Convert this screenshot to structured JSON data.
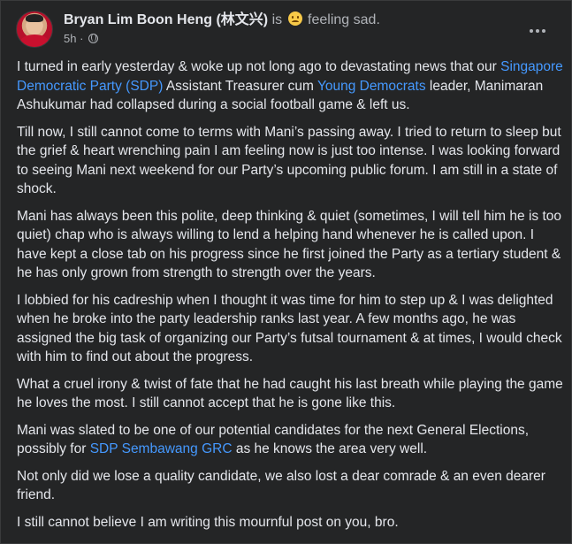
{
  "post": {
    "author": "Bryan Lim Boon Heng (林文兴)",
    "is_text": "is",
    "feeling": "feeling sad.",
    "feeling_icon": "sad-face-emoji",
    "time": "5h",
    "dot": "·",
    "privacy_icon": "globe-icon",
    "more_icon": "more-horizontal-icon",
    "paragraphs": {
      "p1": {
        "a": "I turned in early yesterday & woke up not long ago to devastating news that our ",
        "link1": "Singapore Democratic Party (SDP)",
        "b": " Assistant Treasurer cum ",
        "link2": "Young Democrats",
        "c": " leader, Manimaran Ashukumar had collapsed during a social football game & left us."
      },
      "p2": "Till now, I still cannot come to terms with Mani’s passing away.  I tried to return to sleep but the grief & heart wrenching pain I am feeling now is just too intense.  I was looking forward to seeing Mani next weekend for our Party’s upcoming public forum.  I am still in a state of shock.",
      "p3": "Mani has always been this polite, deep thinking & quiet (sometimes, I will tell him he is too quiet) chap who is always willing to lend a helping hand whenever he is called upon.  I have kept a close tab on his progress since he first joined the Party as a tertiary student & he has only grown from strength to strength over the years.",
      "p4": "I lobbied for his cadreship when I thought it was time for him to step up & I was delighted when he broke into the party leadership ranks last year.  A few months ago, he was assigned the big task of organizing our Party’s futsal tournament & at times, I would check with him to find out about the progress.",
      "p5": "What a cruel irony & twist of fate that he had caught his last breath while playing the game he loves the most.  I still cannot accept that he is gone like this.",
      "p6": {
        "a": "Mani was slated to be one of our potential candidates for the next General Elections, possibly for ",
        "link": "SDP Sembawang GRC",
        "b": " as he knows the area very well."
      },
      "p7": "Not only did we lose a quality candidate, we also lost a dear comrade & an even dearer friend.",
      "p8": "I still cannot believe I am writing this mournful post on you, bro."
    }
  },
  "colors": {
    "background": "#242526",
    "text": "#e4e6eb",
    "secondary_text": "#b0b3b8",
    "link": "#4599ff"
  }
}
